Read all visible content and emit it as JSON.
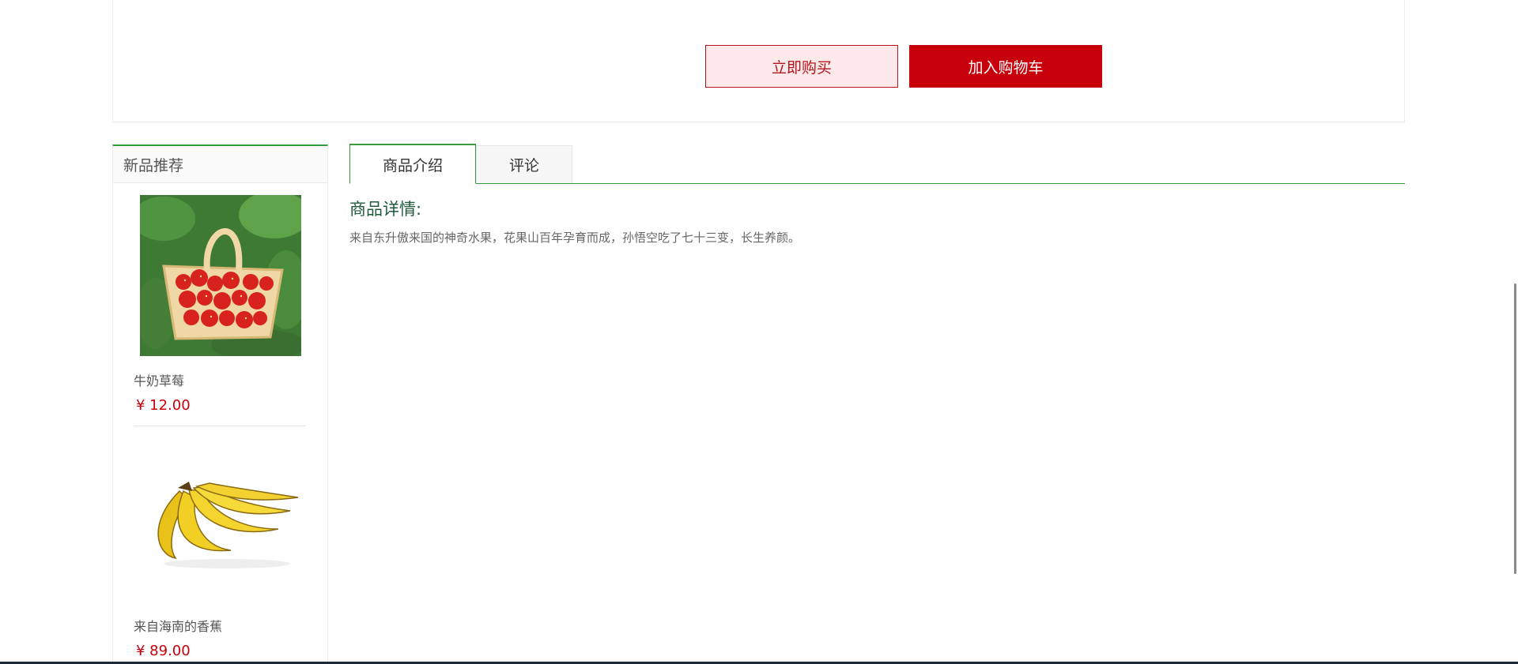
{
  "actions": {
    "buy_now_label": "立即购买",
    "add_to_cart_label": "加入购物车"
  },
  "sidebar": {
    "title": "新品推荐",
    "products": [
      {
        "name": "牛奶草莓",
        "price": "¥ 12.00",
        "image": "strawberry-basket-image"
      },
      {
        "name": "来自海南的香蕉",
        "price": "¥ 89.00",
        "image": "banana-bunch-image"
      }
    ]
  },
  "tabs": {
    "items": [
      {
        "label": "商品介绍",
        "active": true
      },
      {
        "label": "评论",
        "active": false
      }
    ]
  },
  "detail": {
    "title": "商品详情:",
    "description": "来自东升傲来国的神奇水果，花果山百年孕育而成，孙悟空吃了七十三变，长生养颜。"
  },
  "colors": {
    "accent_green": "#3a9b3e",
    "brand_red": "#c8000b",
    "buy_bg": "#fde9ea"
  }
}
